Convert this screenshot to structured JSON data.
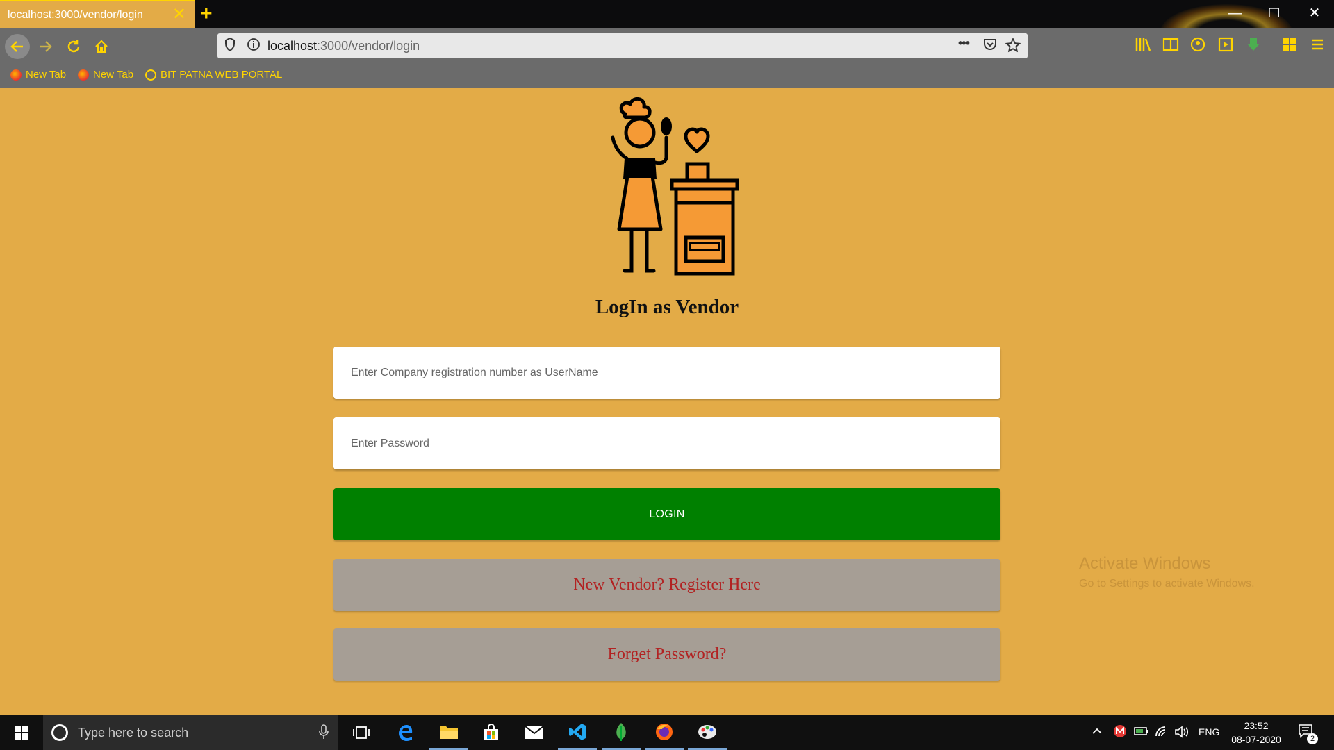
{
  "browser": {
    "tab_title": "localhost:3000/vendor/login",
    "tab_close": "✕",
    "new_tab": "+",
    "url_host": "localhost",
    "url_path": ":3000/vendor/login",
    "url_more": "•••",
    "window_controls": {
      "minimize": "—",
      "restore": "❐",
      "close": "✕"
    },
    "bookmarks": [
      {
        "label": "New Tab",
        "icon": "firefox-icon"
      },
      {
        "label": "New Tab",
        "icon": "firefox-icon"
      },
      {
        "label": "BIT PATNA WEB PORTAL",
        "icon": "globe-icon"
      }
    ]
  },
  "page": {
    "title": "LogIn as Vendor",
    "username_placeholder": "Enter Company registration number as UserName",
    "password_placeholder": "Enter Password",
    "login_label": "LOGIN",
    "register_label": "New Vendor? Register Here",
    "forgot_label": "Forget Password?",
    "logo_icon": "vendor-chef-icon"
  },
  "watermark": {
    "title": "Activate Windows",
    "subtitle": "Go to Settings to activate Windows."
  },
  "taskbar": {
    "search_placeholder": "Type here to search",
    "language": "ENG",
    "time": "23:52",
    "date": "08-07-2020",
    "notification_count": "2"
  },
  "colors": {
    "page_background": "#e3ab47",
    "login_button": "#008000",
    "secondary_button": "#a69e95",
    "secondary_text": "#b22222",
    "accent": "#ffd400"
  }
}
